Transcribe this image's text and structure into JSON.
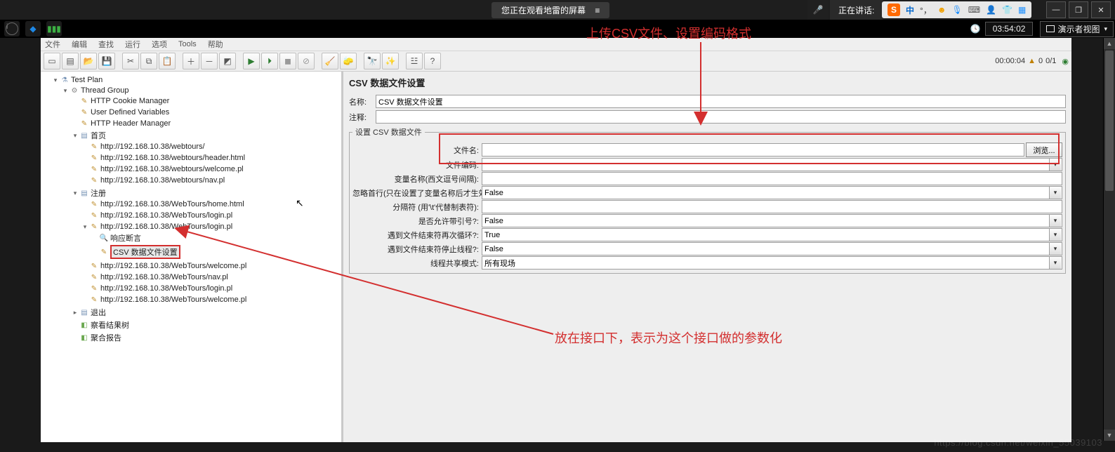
{
  "osbar": {
    "sharing_text": "您正在观看地雷的屏幕",
    "speaking_label": "正在讲话:",
    "ime_lang": "中"
  },
  "secbar": {
    "clock": "03:54:02",
    "presenter_view": "演示者视图"
  },
  "menu": {
    "items": [
      "文件",
      "编辑",
      "查找",
      "运行",
      "选项",
      "Tools",
      "帮助"
    ]
  },
  "toolbar_right": {
    "elapsed": "00:00:04",
    "warn": "0",
    "err": "0/1"
  },
  "tree": {
    "root": "Test Plan",
    "thread_group": "Thread Group",
    "cookie_mgr": "HTTP Cookie Manager",
    "user_vars": "User Defined Variables",
    "header_mgr": "HTTP Header Manager",
    "home": "首页",
    "home_items": [
      "http://192.168.10.38/webtours/",
      "http://192.168.10.38/webtours/header.html",
      "http://192.168.10.38/webtours/welcome.pl",
      "http://192.168.10.38/webtours/nav.pl"
    ],
    "login": "注册",
    "login_items_a": [
      "http://192.168.10.38/WebTours/home.html",
      "http://192.168.10.38/WebTours/login.pl"
    ],
    "login_open": "http://192.168.10.38/WebTours/login.pl",
    "resp_assert": "响应断言",
    "csv_node": "CSV 数据文件设置",
    "login_items_b": [
      "http://192.168.10.38/WebTours/welcome.pl",
      "http://192.168.10.38/WebTours/nav.pl",
      "http://192.168.10.38/WebTours/login.pl",
      "http://192.168.10.38/WebTours/welcome.pl"
    ],
    "logout": "退出",
    "view_tree": "察看结果树",
    "agg_report": "聚合报告"
  },
  "panel": {
    "title": "CSV 数据文件设置",
    "name_label": "名称:",
    "name_value": "CSV 数据文件设置",
    "comment_label": "注释:",
    "comment_value": "",
    "group_legend": "设置 CSV 数据文件",
    "rows": {
      "filename_label": "文件名:",
      "filename_value": "",
      "browse_btn": "浏览...",
      "encoding_label": "文件编码:",
      "encoding_value": "",
      "varnames_label": "变量名称(西文逗号间隔):",
      "varnames_value": "",
      "ignore_first_label": "忽略首行(只在设置了变量名称后才生效):",
      "ignore_first_value": "False",
      "delimiter_label": "分隔符 (用'\\t'代替制表符):",
      "delimiter_value": "",
      "allow_quote_label": "是否允许带引号?:",
      "allow_quote_value": "False",
      "recycle_label": "遇到文件结束符再次循环?:",
      "recycle_value": "True",
      "stop_eof_label": "遇到文件结束符停止线程?:",
      "stop_eof_value": "False",
      "share_mode_label": "线程共享模式:",
      "share_mode_value": "所有现场"
    }
  },
  "annotations": {
    "top": "上传CSV文件、设置编码格式",
    "bottom": "放在接口下，表示为这个接口做的参数化"
  },
  "watermark": "https://blog.csdn.net/weixin_55039103"
}
